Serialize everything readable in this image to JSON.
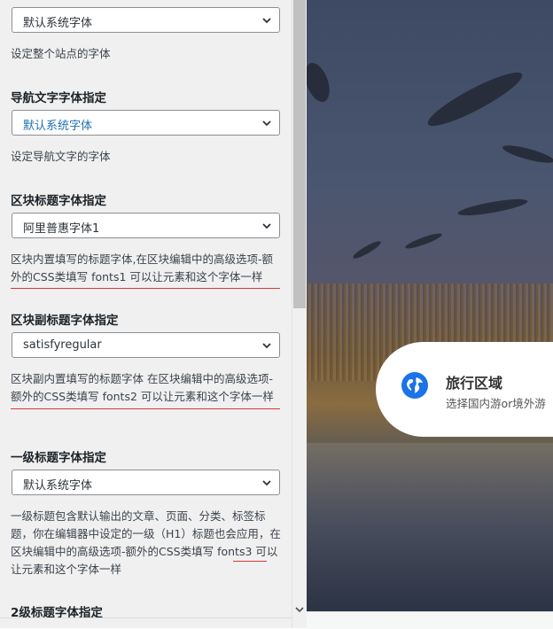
{
  "settings": {
    "sections": [
      {
        "label": "",
        "select_value": "默认系统字体",
        "desc": "设定整个站点的字体"
      },
      {
        "label": "导航文字字体指定",
        "select_value": "默认系统字体",
        "desc": "设定导航文字的字体"
      },
      {
        "label": "区块标题字体指定",
        "select_value": "阿里普惠字体1",
        "desc": "区块内置填写的标题字体,在区块编辑中的高级选项-额外的CSS类填写 fonts1 可以让元素和这个字体一样"
      },
      {
        "label": "区块副标题字体指定",
        "select_value": "satisfyregular",
        "desc": "区块副内置填写的标题字体 在区块编辑中的高级选项-额外的CSS类填写 fonts2 可以让元素和这个字体一样"
      },
      {
        "label": "一级标题字体指定",
        "select_value": "默认系统字体",
        "desc": "一级标题包含默认输出的文章、页面、分类、标签标题，你在编辑器中设定的一级（H1）标题也会应用，在区块编辑中的高级选项-额外的CSS类填写 fonts3 可以让元素和这个字体一样"
      },
      {
        "label": "2级标题字体指定"
      }
    ]
  },
  "preview": {
    "card_title": "旅行区域",
    "card_subtitle": "选择国内游or境外游",
    "icon": "globe-icon"
  },
  "colors": {
    "accent": "#2271b1",
    "underline": "#d63638",
    "card_icon": "#1a73e8"
  }
}
